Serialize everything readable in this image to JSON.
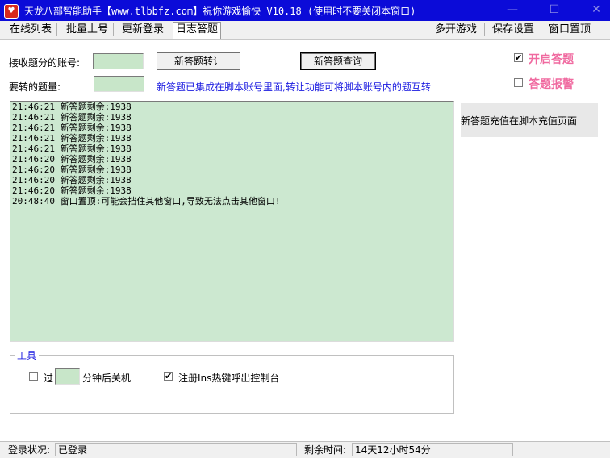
{
  "window": {
    "title": "天龙八部智能助手【www.tlbbfz.com】祝你游戏愉快 V10.18 (使用时不要关闭本窗口)",
    "minimize": "—",
    "maximize": "☐",
    "close": "✕"
  },
  "menu": {
    "left": [
      "在线列表",
      "批量上号",
      "更新登录",
      "日志答题"
    ],
    "right": [
      "多开游戏",
      "保存设置",
      "窗口置顶"
    ],
    "active": "日志答题"
  },
  "form": {
    "account_label": "接收题分的账号:",
    "account_value": "",
    "amount_label": "要转的题量:",
    "amount_value": "",
    "transfer_button": "新答题转让",
    "query_button": "新答题查询",
    "info_text": "新答题已集成在脚本账号里面,转让功能可将脚本账号内的题互转"
  },
  "options": {
    "enable_answer": {
      "label": "开启答题",
      "checked": true
    },
    "answer_alarm": {
      "label": "答题报警",
      "checked": false
    }
  },
  "log": [
    "21:46:21 新答题剩余:1938",
    "21:46:21 新答题剩余:1938",
    "21:46:21 新答题剩余:1938",
    "21:46:21 新答题剩余:1938",
    "21:46:21 新答题剩余:1938",
    "21:46:20 新答题剩余:1938",
    "21:46:20 新答题剩余:1938",
    "21:46:20 新答题剩余:1938",
    "21:46:20 新答题剩余:1938",
    "20:48:40 窗口置顶:可能会挡住其他窗口,导致无法点击其他窗口!"
  ],
  "side_note": "新答题充值在脚本充值页面",
  "tools": {
    "legend": "工具",
    "shutdown_prefix": "过",
    "shutdown_minutes": "",
    "shutdown_suffix": "分钟后关机",
    "shutdown_checked": false,
    "hotkey_label": "注册Ins热键呼出控制台",
    "hotkey_checked": true
  },
  "status": {
    "login_label": "登录状况:",
    "login_value": "已登录",
    "remaining_label": "剩余时间:",
    "remaining_value": "14天12小时54分"
  }
}
